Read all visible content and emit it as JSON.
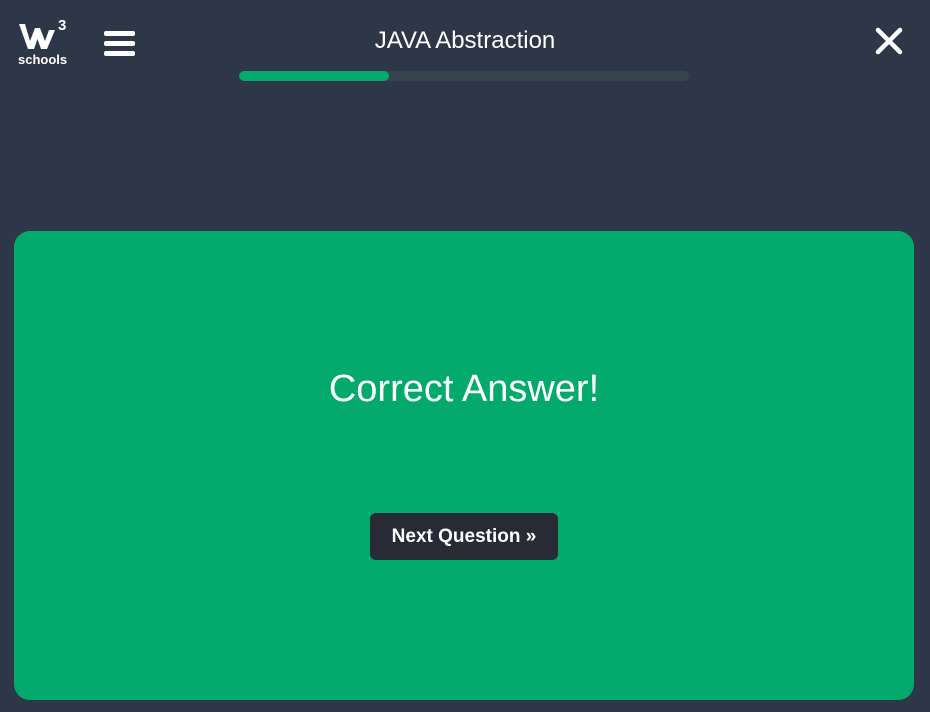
{
  "header": {
    "logo": {
      "superscript": "3",
      "wordmark": "schools",
      "icon": "w3schools-logo-icon"
    },
    "menu_icon": "hamburger-menu-icon",
    "title": "JAVA Abstraction",
    "progress": {
      "fraction": 0.333
    },
    "close_icon": "close-icon"
  },
  "result_panel": {
    "message": "Correct Answer!",
    "next_button_label": "Next Question »"
  },
  "colors": {
    "background": "#2d3748",
    "accent_green": "#04aa6d",
    "progress_track": "#38444d",
    "button_dark": "#282a35",
    "text": "#ffffff"
  }
}
